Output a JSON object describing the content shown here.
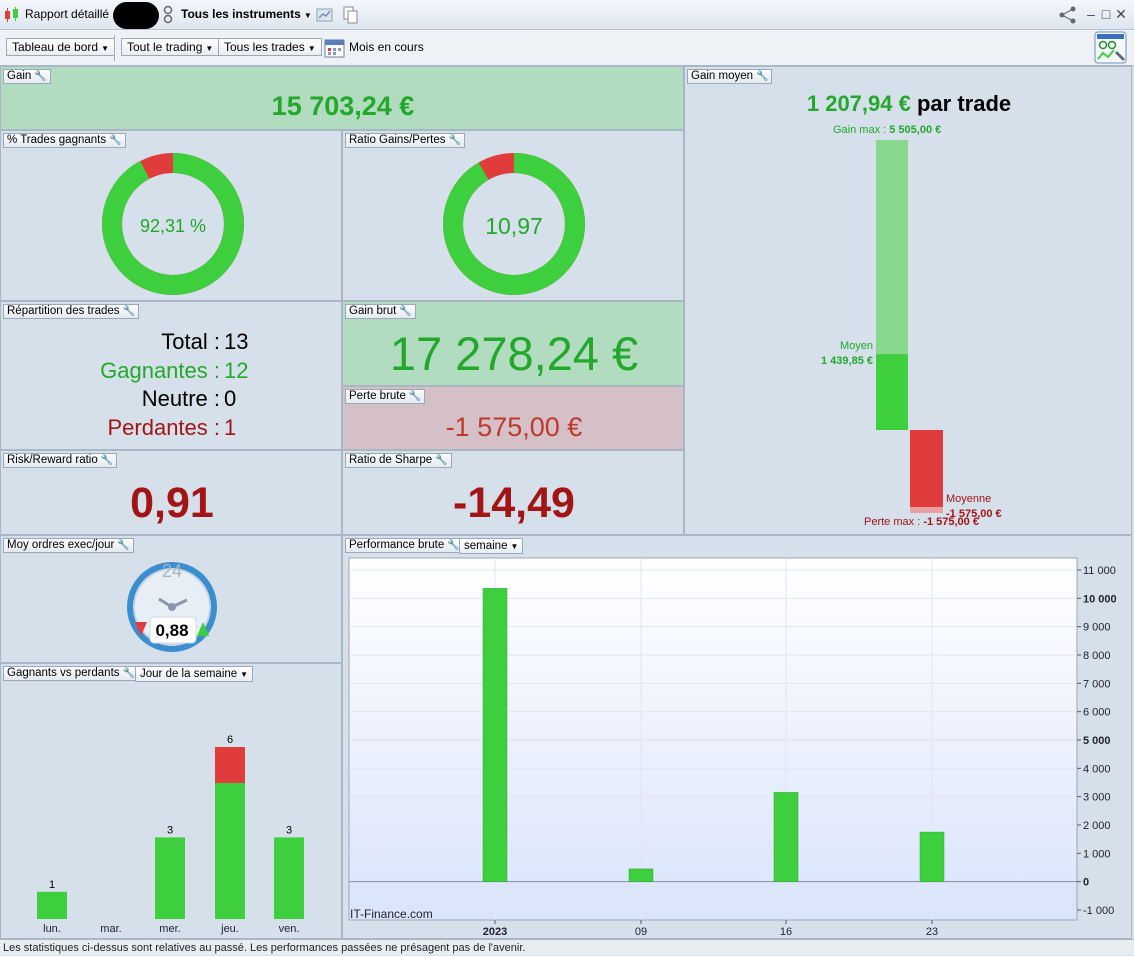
{
  "titlebar": {
    "report_label": "Rapport détaillé",
    "instrument_label": "Tous les instruments"
  },
  "toolbar": {
    "dashboard": "Tableau de bord",
    "trading": "Tout le trading",
    "trades": "Tous les trades",
    "period": "Mois en cours"
  },
  "gain": {
    "title": "Gain",
    "value": "15 703,24 €"
  },
  "win_pct": {
    "title": "% Trades gagnants",
    "value": "92,31 %",
    "fraction": 0.9231
  },
  "ratio_gp": {
    "title": "Ratio Gains/Pertes",
    "value": "10,97",
    "fraction": 0.9165
  },
  "avg_gain": {
    "title": "Gain moyen",
    "value": "1 207,94 €",
    "suffix": "par trade",
    "max_gain_label": "Gain max :",
    "max_gain": "5 505,00 €",
    "avg_label": "Moyen",
    "avg_win": "1 439,85 €",
    "avg_loss_label": "Moyenne",
    "avg_loss": "-1 575,00 €",
    "max_loss_label": "Perte max :",
    "max_loss": "-1 575,00 €",
    "data": {
      "max_gain": 5505,
      "avg_win": 1439.85,
      "avg_loss": -1575,
      "max_loss": -1575
    }
  },
  "distribution": {
    "title": "Répartition des trades",
    "total_label": "Total :",
    "total": "13",
    "win_label": "Gagnantes :",
    "win": "12",
    "neutral_label": "Neutre :",
    "neutral": "0",
    "loss_label": "Perdantes :",
    "loss": "1"
  },
  "gross_gain": {
    "title": "Gain brut",
    "value": "17 278,24 €"
  },
  "gross_loss": {
    "title": "Perte brute",
    "value": "-1 575,00 €"
  },
  "risk_reward": {
    "title": "Risk/Reward ratio",
    "value": "0,91"
  },
  "sharpe": {
    "title": "Ratio de Sharpe",
    "value": "-14,49"
  },
  "orders": {
    "title": "Moy ordres exec/jour",
    "clock_label": "24",
    "value": "0,88"
  },
  "winlose": {
    "title": "Gagnants vs perdants",
    "dropdown": "Jour de la semaine"
  },
  "performance": {
    "title": "Performance brute",
    "dropdown": "semaine",
    "watermark": "IT-Finance.com"
  },
  "footer": {
    "text": "Les statistiques ci-dessus sont relatives au passé. Les performances passées ne présagent pas de l'avenir."
  },
  "colors": {
    "green": "#3ecf3e",
    "red": "#e03c3c",
    "text_green": "#22a82a",
    "text_red": "#a31515"
  },
  "chart_data": [
    {
      "type": "bar",
      "id": "winlose",
      "categories": [
        "lun.",
        "mar.",
        "mer.",
        "jeu.",
        "ven."
      ],
      "series": [
        {
          "name": "",
          "values": [
            1,
            0,
            3,
            5,
            3
          ]
        },
        {
          "name": "",
          "values": [
            0,
            0,
            0,
            1,
            0
          ]
        }
      ],
      "totals": [
        "1",
        "",
        "3",
        "6",
        "3"
      ],
      "ylim": [
        0,
        6
      ]
    },
    {
      "type": "bar",
      "id": "performance",
      "categories": [
        "2023",
        "09",
        "16",
        "23"
      ],
      "values": [
        10350,
        450,
        3150,
        1750
      ],
      "ylim": [
        -1000,
        11000
      ],
      "yticks": [
        "11 000",
        "10 000",
        "9 000",
        "8 000",
        "7 000",
        "6 000",
        "5 000",
        "4 000",
        "3 000",
        "2 000",
        "1 000",
        "0",
        "-1 000"
      ],
      "ytick_values": [
        11000,
        10000,
        9000,
        8000,
        7000,
        6000,
        5000,
        4000,
        3000,
        2000,
        1000,
        0,
        -1000
      ],
      "grid": true
    }
  ]
}
